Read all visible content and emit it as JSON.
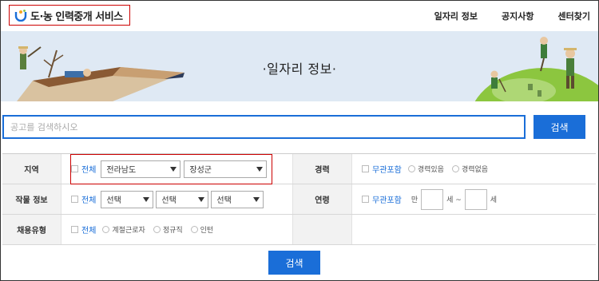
{
  "brand": {
    "name": "도·농 인력중개 서비스"
  },
  "nav": {
    "items": [
      "일자리 정보",
      "공지사항",
      "센터찾기"
    ]
  },
  "banner": {
    "title": "·일자리 정보·"
  },
  "search": {
    "placeholder": "공고를 검색하시오",
    "button": "검색"
  },
  "filters": {
    "region": {
      "label": "지역",
      "all": "전체",
      "province": "전라남도",
      "county": "장성군"
    },
    "crop": {
      "label": "작물 정보",
      "all": "전체",
      "selects": [
        "선택",
        "선택",
        "선택"
      ]
    },
    "employment": {
      "label": "채용유형",
      "all": "전체",
      "options": [
        "계절근로자",
        "정규직",
        "인턴"
      ]
    },
    "career": {
      "label": "경력",
      "any": "무관포함",
      "options": [
        "경력있음",
        "경력없음"
      ]
    },
    "age": {
      "label": "연령",
      "any": "무관포함",
      "prefix": "만",
      "from_suffix": "세 ~",
      "to_suffix": "세"
    }
  },
  "submit": {
    "label": "검색"
  },
  "colors": {
    "accent": "#1a6ed8",
    "highlight": "#cc0000",
    "banner_bg": "#dfe9f4"
  }
}
